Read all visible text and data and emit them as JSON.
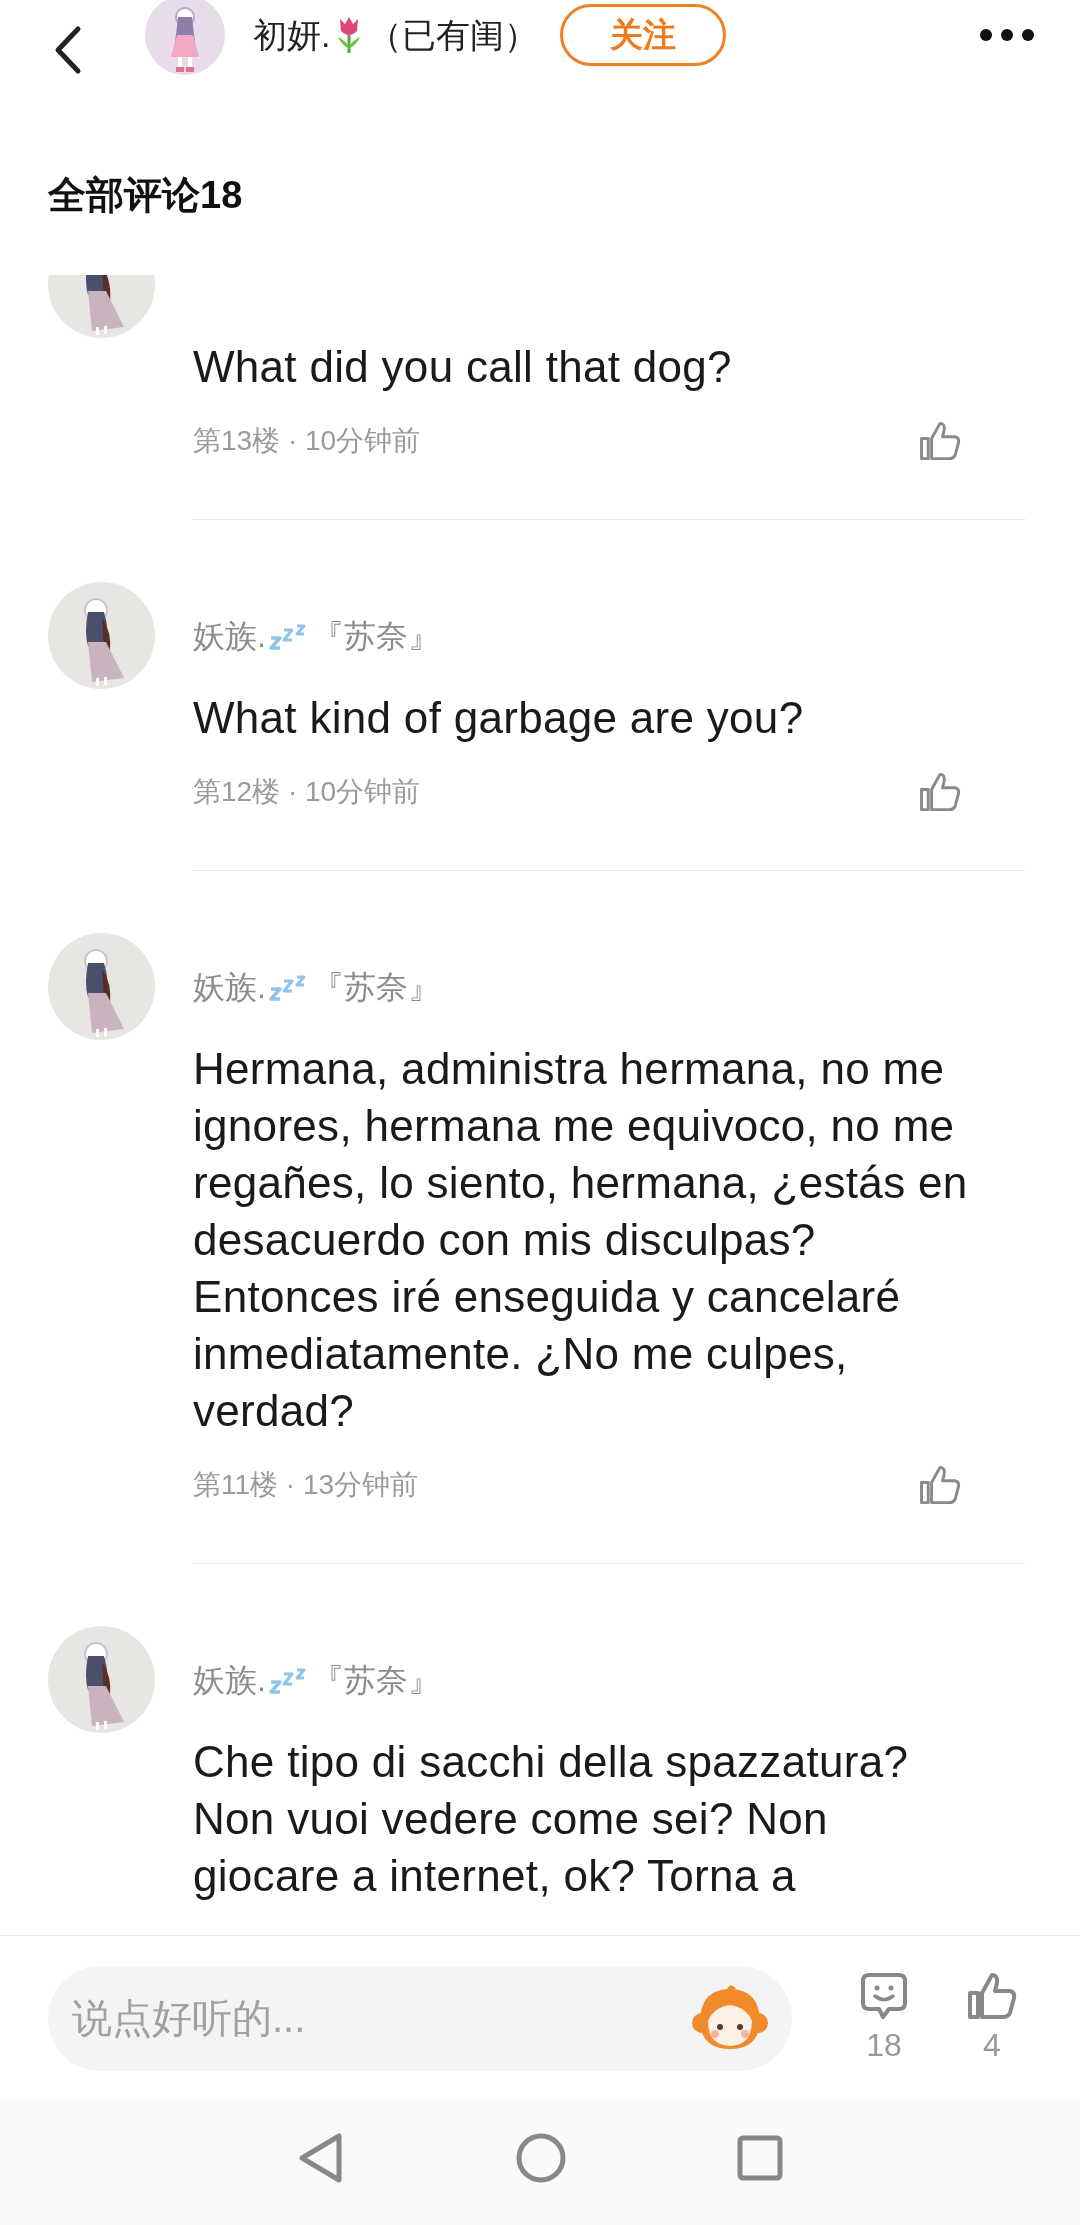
{
  "header": {
    "name_before": "初妍.",
    "name_after": "（已有闺）",
    "follow_button": "关注"
  },
  "section_title": "全部评论18",
  "comments": [
    {
      "text": "What did you call that dog?",
      "meta": "第13楼 · 10分钟前"
    },
    {
      "user_name": "妖族.",
      "user_tag": "『苏奈』",
      "text": "What kind of garbage are you?",
      "meta": "第12楼 · 10分钟前"
    },
    {
      "user_name": "妖族.",
      "user_tag": "『苏奈』",
      "text": "Hermana, administra hermana, no me ignores, hermana me equivoco, no me regañes, lo siento, hermana, ¿estás en desacuerdo con mis disculpas? Entonces iré enseguida y cancelaré inmediatamente. ¿No me culpes, verdad?",
      "meta": "第11楼 · 13分钟前"
    },
    {
      "user_name": "妖族.",
      "user_tag": "『苏奈』",
      "text": "Che tipo di sacchi della spazzatura? Non vuoi vedere come sei? Non giocare a internet, ok? Torna a"
    }
  ],
  "composer": {
    "placeholder": "说点好听的...",
    "comment_count": "18",
    "like_count": "4"
  }
}
